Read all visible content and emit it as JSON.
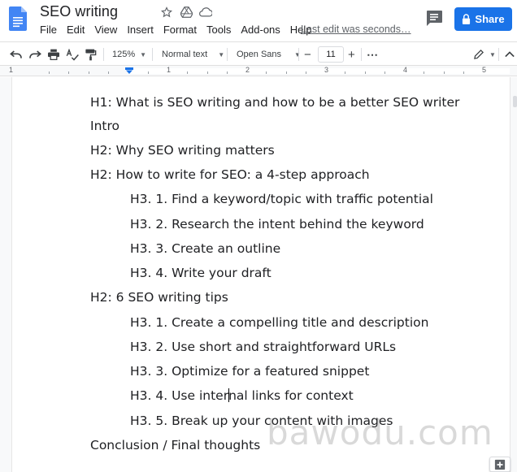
{
  "app": {
    "doc_title": "SEO writing",
    "last_edit": "Last edit was seconds…",
    "share_label": "Share",
    "brand_color": "#1a73e8"
  },
  "menu": [
    "File",
    "Edit",
    "View",
    "Insert",
    "Format",
    "Tools",
    "Add-ons",
    "Help"
  ],
  "toolbar": {
    "zoom": "125%",
    "style": "Normal text",
    "font": "Open Sans",
    "font_size": "11",
    "minus": "−",
    "plus": "+",
    "more": "⋯"
  },
  "ruler": {
    "numbers": [
      "1",
      "1",
      "2",
      "3",
      "4",
      "5"
    ]
  },
  "document": {
    "lines": [
      {
        "text": "H1: What is SEO writing and how to be a better SEO writer",
        "level": 1
      },
      {
        "text": "Intro",
        "level": 1
      },
      {
        "text": "H2: Why SEO writing matters",
        "level": 1
      },
      {
        "text": "H2: How to write for SEO: a 4-step approach",
        "level": 1
      },
      {
        "text": "H3. 1. Find a keyword/topic with traffic potential",
        "level": 2
      },
      {
        "text": "H3. 2. Research the intent behind the keyword",
        "level": 2
      },
      {
        "text": "H3. 3. Create an outline",
        "level": 2
      },
      {
        "text": "H3. 4. Write your draft",
        "level": 2
      },
      {
        "text": "H2: 6 SEO writing tips",
        "level": 1
      },
      {
        "text": "H3. 1. Create a compelling title and description",
        "level": 2
      },
      {
        "text": "H3. 2. Use short and straightforward URLs",
        "level": 2
      },
      {
        "text": "H3. 3. Optimize for a featured snippet",
        "level": 2
      },
      {
        "text": "H3. 4. Use internal links for context",
        "level": 2,
        "cursor_before": "H3. 4. Use inter",
        "cursor_after": "nal links for context"
      },
      {
        "text": "H3. 5. Break up your content with images",
        "level": 2
      },
      {
        "text": "Conclusion / Final thoughts",
        "level": 1
      }
    ]
  },
  "watermark": "bawodu.com",
  "icons": [
    "docs-logo-icon",
    "star-icon",
    "drive-move-icon",
    "cloud-status-icon",
    "comment-icon",
    "lock-icon",
    "undo-icon",
    "redo-icon",
    "print-icon",
    "spellcheck-icon",
    "paint-format-icon",
    "more-icon",
    "edit-mode-icon",
    "collapse-icon",
    "explore-icon"
  ]
}
